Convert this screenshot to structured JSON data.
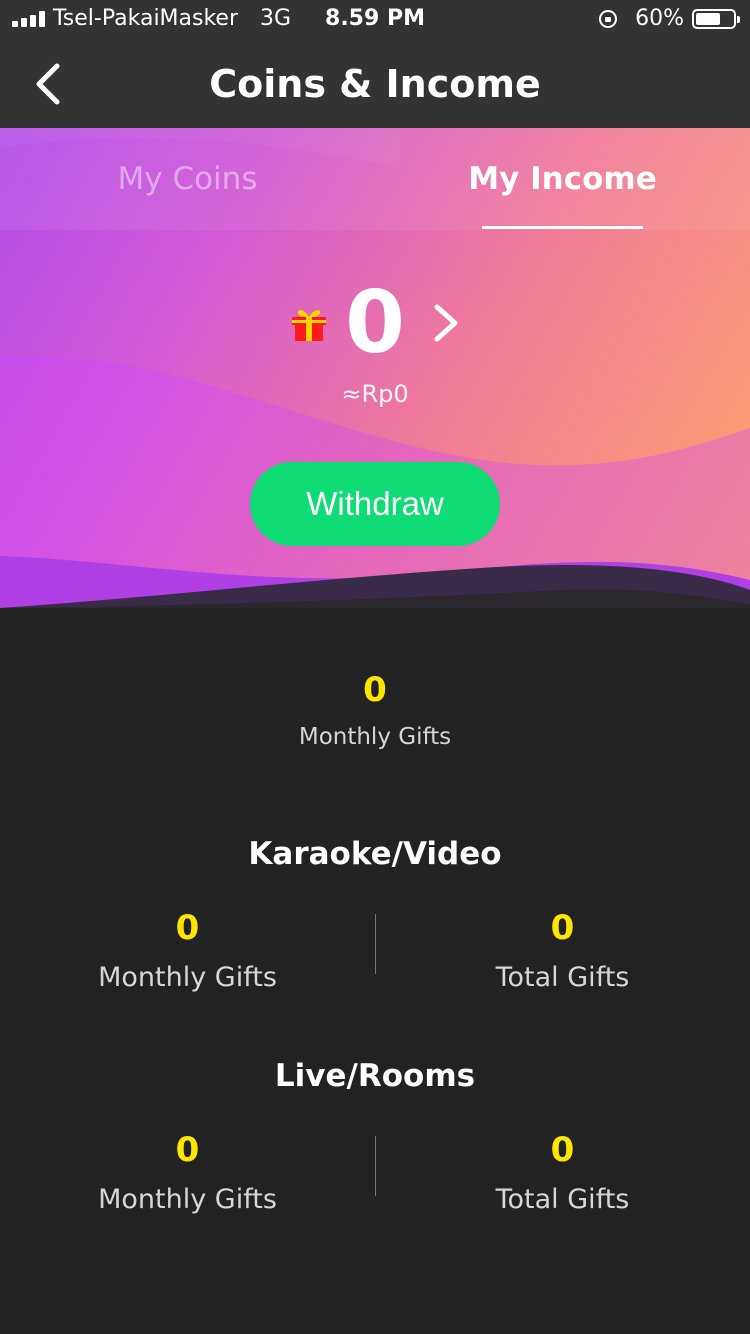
{
  "status_bar": {
    "carrier": "Tsel-PakaiMasker",
    "network": "3G",
    "time": "8.59 PM",
    "battery": "60%"
  },
  "nav": {
    "title": "Coins & Income",
    "back_icon": "chevron-left-icon"
  },
  "tabs": {
    "coins": "My Coins",
    "income": "My Income",
    "active": "My Income"
  },
  "balance": {
    "value": "0",
    "approx": "≈Rp0",
    "icon": "gift-icon"
  },
  "withdraw_label": "Withdraw",
  "monthly": {
    "value": "0",
    "label": "Monthly Gifts"
  },
  "sections": [
    {
      "title": "Karaoke/Video",
      "monthly_value": "0",
      "monthly_label": "Monthly Gifts",
      "total_value": "0",
      "total_label": "Total Gifts"
    },
    {
      "title": "Live/Rooms",
      "monthly_value": "0",
      "monthly_label": "Monthly Gifts",
      "total_value": "0",
      "total_label": "Total Gifts"
    }
  ],
  "colors": {
    "accent_green": "#0fdc74",
    "stat_yellow": "#ffe600",
    "background": "#222222",
    "bar": "#333333"
  }
}
